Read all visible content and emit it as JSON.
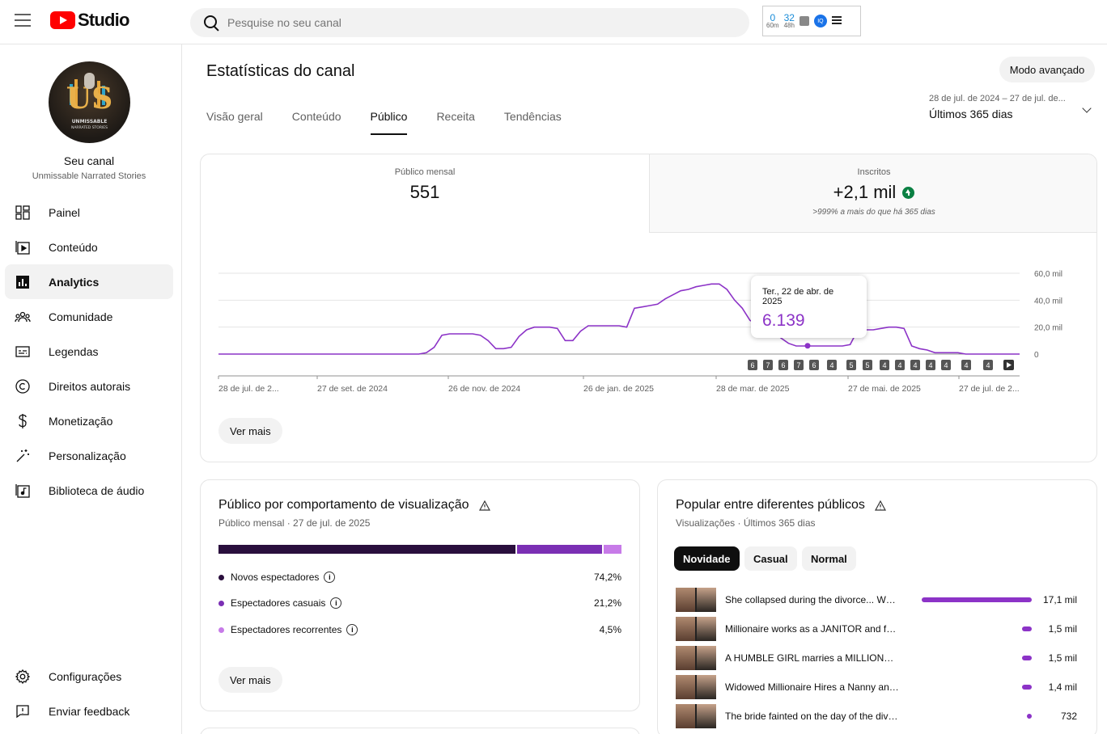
{
  "header": {
    "logo_text": "Studio",
    "search_placeholder": "Pesquise no seu canal",
    "extension": {
      "stat1_value": "0",
      "stat1_label": "60m",
      "stat2_value": "32",
      "stat2_label": "48h",
      "badge": "IQ"
    }
  },
  "sidebar": {
    "channel_title": "Seu canal",
    "channel_name": "Unmissable Narrated Stories",
    "avatar_text": {
      "letters": "US",
      "line1": "UNMISSABLE",
      "line2": "NARRATED STORIES"
    },
    "items": [
      {
        "label": "Painel",
        "icon": "dashboard-icon"
      },
      {
        "label": "Conteúdo",
        "icon": "content-icon"
      },
      {
        "label": "Analytics",
        "icon": "analytics-icon",
        "active": true
      },
      {
        "label": "Comunidade",
        "icon": "community-icon"
      },
      {
        "label": "Legendas",
        "icon": "subtitles-icon"
      },
      {
        "label": "Direitos autorais",
        "icon": "copyright-icon"
      },
      {
        "label": "Monetização",
        "icon": "dollar-icon"
      },
      {
        "label": "Personalização",
        "icon": "magic-wand-icon"
      },
      {
        "label": "Biblioteca de áudio",
        "icon": "audio-library-icon"
      }
    ],
    "bottom_items": [
      {
        "label": "Configurações",
        "icon": "gear-icon"
      },
      {
        "label": "Enviar feedback",
        "icon": "feedback-icon"
      }
    ]
  },
  "main": {
    "title": "Estatísticas do canal",
    "advanced_mode": "Modo avançado",
    "tabs": [
      "Visão geral",
      "Conteúdo",
      "Público",
      "Receita",
      "Tendências"
    ],
    "active_tab": "Público",
    "date_range": {
      "range": "28 de jul. de 2024 – 27 de jul. de...",
      "label": "Últimos 365 dias"
    }
  },
  "overview_card": {
    "metric1": {
      "label": "Público mensal",
      "value": "551"
    },
    "metric2": {
      "label": "Inscritos",
      "value": "+2,1 mil",
      "note": ">999% a mais do que há 365 dias"
    },
    "tooltip": {
      "date": "Ter., 22 de abr. de 2025",
      "value": "6.139"
    },
    "see_more": "Ver mais"
  },
  "chart_data": {
    "type": "line",
    "series": [
      {
        "values": [
          0,
          0,
          0,
          0,
          0,
          0,
          0,
          0,
          0,
          0,
          0,
          0,
          0,
          0,
          0,
          0,
          0,
          0,
          0,
          0,
          0,
          0,
          0,
          0,
          0,
          0,
          0,
          1,
          5,
          14,
          15,
          15,
          15,
          15,
          14,
          10,
          4,
          4,
          5,
          13,
          18,
          20,
          20,
          20,
          19,
          10,
          10,
          17,
          21,
          21,
          21,
          21,
          21,
          20,
          34,
          35,
          36,
          37,
          41,
          44,
          47,
          48,
          50,
          51,
          52,
          52,
          48,
          40,
          34,
          25,
          22,
          21,
          18,
          12,
          8,
          6,
          6,
          6,
          6,
          6,
          6,
          6,
          7,
          18,
          18,
          18,
          19,
          20,
          20,
          19,
          6,
          4,
          3,
          1,
          1,
          1,
          1,
          0,
          0,
          0,
          0,
          0,
          0,
          0,
          0
        ]
      }
    ],
    "x_ticks": [
      "28 de jul. de 2...",
      "27 de set. de 2024",
      "26 de nov. de 2024",
      "26 de jan. de 2025",
      "28 de mar. de 2025",
      "27 de mai. de 2025",
      "27 de jul. de 2..."
    ],
    "y_ticks": [
      "60,0 mil",
      "40,0 mil",
      "20,0 mil",
      "0"
    ],
    "ylim": [
      0,
      60000
    ],
    "upload_markers": [
      "6",
      "7",
      "6",
      "7",
      "6",
      "4",
      "5",
      "5",
      "4",
      "4",
      "4",
      "4",
      "4",
      "4",
      "4"
    ],
    "highlight": {
      "date": "22 de abr. de 2025",
      "value": 6139
    },
    "color": "#8c33c7"
  },
  "behavior_card": {
    "title": "Público por comportamento de visualização",
    "subtitle": "Público mensal · 27 de jul. de 2025",
    "segments": [
      {
        "label": "Novos espectadores",
        "pct": "74,2%",
        "value": 74.2,
        "color": "#2a0f3d"
      },
      {
        "label": "Espectadores casuais",
        "pct": "21,2%",
        "value": 21.2,
        "color": "#7b2fb4"
      },
      {
        "label": "Espectadores recorrentes",
        "pct": "4,5%",
        "value": 4.5,
        "color": "#c77be8"
      }
    ],
    "see_more": "Ver mais"
  },
  "popular_card": {
    "title": "Popular entre diferentes públicos",
    "subtitle": "Visualizações · Últimos 365 dias",
    "chips": [
      "Novidade",
      "Casual",
      "Normal"
    ],
    "active_chip": "Novidade",
    "videos": [
      {
        "title": "She collapsed during the divorce... Wha...",
        "views": "17,1 mil",
        "value": 17100
      },
      {
        "title": "Millionaire works as a JANITOR and fall...",
        "views": "1,5 mil",
        "value": 1500
      },
      {
        "title": "A HUMBLE GIRL marries a MILLIONAIR...",
        "views": "1,5 mil",
        "value": 1500
      },
      {
        "title": "Widowed Millionaire Hires a Nanny and ...",
        "views": "1,4 mil",
        "value": 1400
      },
      {
        "title": "The bride fainted on the day of the divor...",
        "views": "732",
        "value": 732
      }
    ]
  }
}
